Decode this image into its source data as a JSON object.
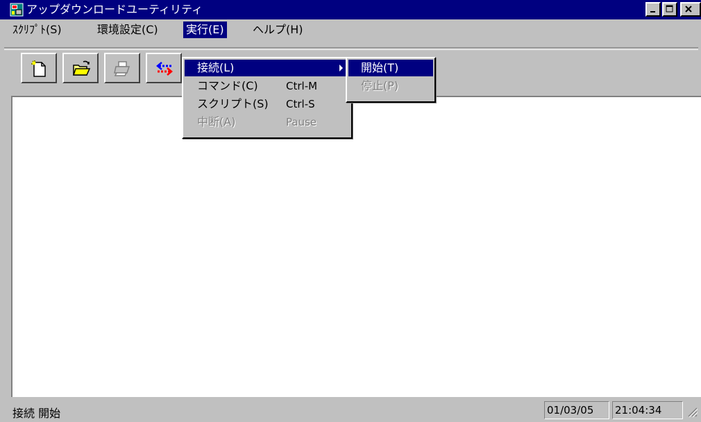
{
  "window": {
    "title": "アップダウンロードユーティリティ"
  },
  "menubar": {
    "items": [
      "ｽｸﾘﾌﾟﾄ(S)",
      "環境設定(C)",
      "実行(E)",
      "ヘルプ(H)"
    ],
    "active_index": 2
  },
  "toolbar": {
    "icons": [
      "new-file-icon",
      "open-folder-icon",
      "print-icon",
      "connect-icon"
    ]
  },
  "run_menu": {
    "items": [
      {
        "label": "接続(L)",
        "shortcut": "",
        "submenu": true,
        "highlighted": true,
        "disabled": false
      },
      {
        "label": "コマンド(C)",
        "shortcut": "Ctrl-M",
        "submenu": false,
        "highlighted": false,
        "disabled": false
      },
      {
        "label": "スクリプト(S)",
        "shortcut": "Ctrl-S",
        "submenu": false,
        "highlighted": false,
        "disabled": false
      },
      {
        "label": "中断(A)",
        "shortcut": "Pause",
        "submenu": false,
        "highlighted": false,
        "disabled": true
      }
    ]
  },
  "connect_submenu": {
    "items": [
      {
        "label": "開始(T)",
        "highlighted": true,
        "disabled": false
      },
      {
        "label": "停止(P)",
        "highlighted": false,
        "disabled": true
      }
    ]
  },
  "statusbar": {
    "message": "接続 開始",
    "date": "01/03/05",
    "time": "21:04:34"
  },
  "colors": {
    "titlebar": "#000080",
    "face": "#c0c0c0",
    "highlight": "#000080"
  }
}
